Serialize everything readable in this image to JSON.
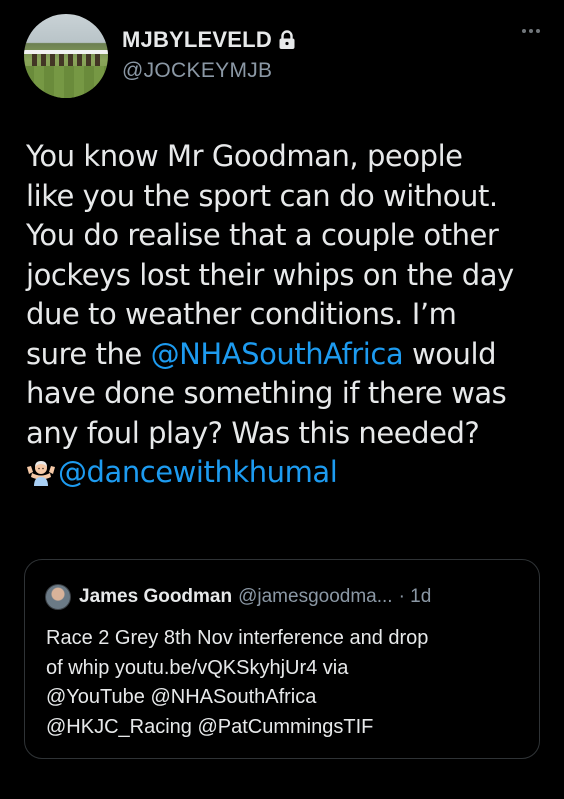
{
  "author": {
    "display_name": "MJBYLEVELD",
    "handle": "@JOCKEYMJB"
  },
  "tweet": {
    "lines": [
      "You know Mr Goodman, people",
      "like you the sport can do without.",
      "You do realise that a couple other",
      "jockeys lost their whips on the day",
      "due to weather conditions. I’m"
    ],
    "line6_pre": "sure the ",
    "line6_mention": "@NHASouthAfrica",
    "line6_post": " would",
    "line7": "have done something if there was",
    "line8": "any foul play? Was this needed?",
    "final_mention": "@dancewithkhumal"
  },
  "quoted_tweet": {
    "display_name": "James Goodman",
    "handle": "@jamesgoodma...",
    "time": "· 1d",
    "lines": [
      "Race 2 Grey 8th Nov interference and drop",
      "of whip youtu.be/vQKSkyhjUr4 via",
      "@YouTube @NHASouthAfrica",
      "@HKJC_Racing @PatCummingsTIF"
    ]
  },
  "colors": {
    "background": "#000000",
    "text": "#e7e9ea",
    "secondary": "#8b98a5",
    "link": "#1d9bf0",
    "border": "#2f3336"
  }
}
